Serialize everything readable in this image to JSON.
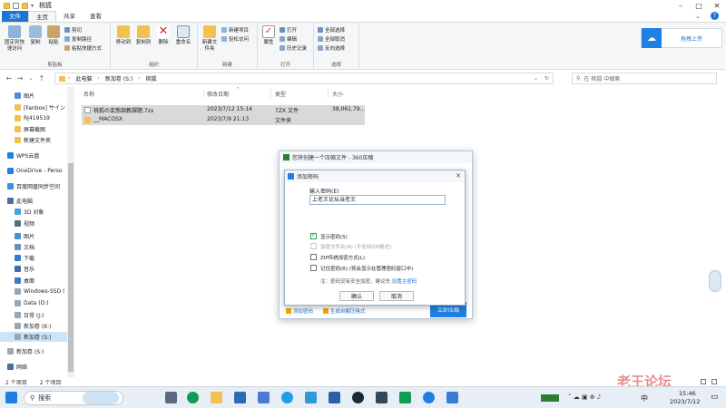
{
  "window": {
    "title": "桃狐"
  },
  "ribbon_tabs": [
    "文件",
    "主页",
    "共享",
    "查看"
  ],
  "ribbon": {
    "clipboard": {
      "pin": "固定到快速访问",
      "copy": "复制",
      "paste": "粘贴",
      "cut": "剪切",
      "copy_path": "复制路径",
      "paste_shortcut": "粘贴快捷方式",
      "label": "剪贴板"
    },
    "organize": {
      "move_to": "移动到",
      "copy_to": "复制到",
      "delete": "删除",
      "rename": "重命名",
      "label": "组织"
    },
    "new": {
      "new_folder": "新建文件夹",
      "new_item": "新建项目",
      "easy_access": "轻松访问",
      "label": "新建"
    },
    "open": {
      "properties": "属性",
      "open": "打开",
      "edit": "编辑",
      "history": "历史记录",
      "label": "打开"
    },
    "select": {
      "select_all": "全部选择",
      "select_none": "全部取消",
      "invert": "反向选择",
      "label": "选择"
    },
    "upload": "拖拽上传"
  },
  "address": {
    "crumbs": [
      "此电脑",
      "新加卷 (S:)",
      "桃狐"
    ],
    "search_placeholder": "在 桃狐 中搜索"
  },
  "sidebar": [
    {
      "label": "图片",
      "icon": "pictures-icon"
    },
    {
      "label": "[Fanbox] サイン",
      "icon": "folder-icon"
    },
    {
      "label": "RJ419519",
      "icon": "folder-icon"
    },
    {
      "label": "屏幕截图",
      "icon": "folder-icon"
    },
    {
      "label": "新建文件夹",
      "icon": "folder-icon"
    },
    {
      "label": "WPS云盘",
      "icon": "cloud-icon"
    },
    {
      "label": "OneDrive - Perso",
      "icon": "onedrive-icon"
    },
    {
      "label": "百度网盘同步空间",
      "icon": "baidu-icon"
    },
    {
      "label": "此电脑",
      "icon": "pc-icon"
    },
    {
      "label": "3D 对象",
      "icon": "3d-icon"
    },
    {
      "label": "视频",
      "icon": "video-icon"
    },
    {
      "label": "图片",
      "icon": "pictures-icon"
    },
    {
      "label": "文档",
      "icon": "documents-icon"
    },
    {
      "label": "下载",
      "icon": "download-icon"
    },
    {
      "label": "音乐",
      "icon": "music-icon"
    },
    {
      "label": "桌面",
      "icon": "desktop-icon"
    },
    {
      "label": "Windows-SSD (",
      "icon": "drive-icon"
    },
    {
      "label": "Data (D:)",
      "icon": "drive-icon"
    },
    {
      "label": "日常 (J:)",
      "icon": "drive-icon"
    },
    {
      "label": "新加卷 (K:)",
      "icon": "drive-icon"
    },
    {
      "label": "新加卷 (S:)",
      "icon": "drive-icon"
    },
    {
      "label": "新加卷 (S:)",
      "icon": "drive-icon"
    },
    {
      "label": "网络",
      "icon": "network-icon"
    }
  ],
  "columns": [
    "名称",
    "修改日期",
    "类型",
    "大小"
  ],
  "files": [
    {
      "name": "桃狐の変態調教課題.7zx",
      "date": "2023/7/12 15:14",
      "type": "7ZX 文件",
      "size": "38,061,79..."
    },
    {
      "name": "__MACOSX",
      "date": "2023/7/9 21:13",
      "type": "文件夹",
      "size": ""
    }
  ],
  "status": {
    "count": "2 个项目",
    "selected": "2 个项目"
  },
  "dialog_outer": {
    "title": "您将创建一个压缩文件 - 360压缩",
    "add_pwd": "添加密码",
    "self_extract": "生成自解压格式",
    "create": "立即压缩"
  },
  "dialog_inner": {
    "title": "添加密码",
    "prompt": "输入密码(E)",
    "password": "上老王论坛当老王",
    "show_pwd": "显示密码(S)",
    "encrypt_names": "加密文件名(N) (不支持ZIP格式)",
    "zip_compat": "ZIP传统加密方式(L)",
    "remember": "记住密码(R) (将会显示在管理密码窗口中)",
    "note_prefix": "注：密码没有安全加密，建议先",
    "note_link": "设置主密码",
    "ok": "确认",
    "cancel": "取消"
  },
  "taskbar": {
    "search": "搜索",
    "lang": "中",
    "time": "15:46",
    "date": "2023/7/12"
  },
  "watermark": "老王论坛",
  "colors": {
    "accent": "#1976d2",
    "selection": "#d9d9d9",
    "folder": "#f2c14e"
  }
}
